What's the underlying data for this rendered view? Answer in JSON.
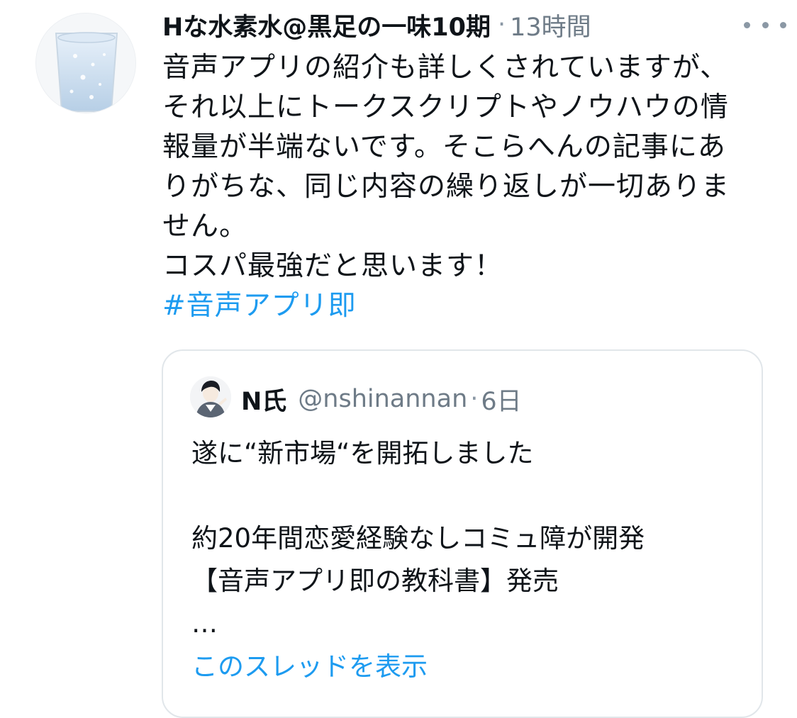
{
  "tweet": {
    "display_name": "Hな水素水@黒足の一味10期",
    "separator": "·",
    "timestamp": "13時間",
    "more_icon": "more-horizontal-icon",
    "lines": [
      "音声アプリの紹介も詳しくされていますが、",
      "それ以上にトークスクリプトやノウハウの情",
      "報量が半端ないです。そこらへんの記事にあ",
      "りがちな、同じ内容の繰り返しが一切ありま",
      "せん。",
      "コスパ最強だと思います！"
    ],
    "hashtag": "#音声アプリ即"
  },
  "quote": {
    "display_name": "N氏",
    "handle": "@nshinannan",
    "separator": "·",
    "timestamp": "6日",
    "lines": [
      "遂に“新市場“を開拓しました",
      "",
      "約20年間恋愛経験なしコミュ障が開発",
      "【音声アプリ即の教科書】発売",
      "…"
    ],
    "show_thread": "このスレッドを表示"
  },
  "colors": {
    "link": "#1d9bf0",
    "secondary_text": "#6e7b87",
    "border": "#e1e6ea"
  }
}
